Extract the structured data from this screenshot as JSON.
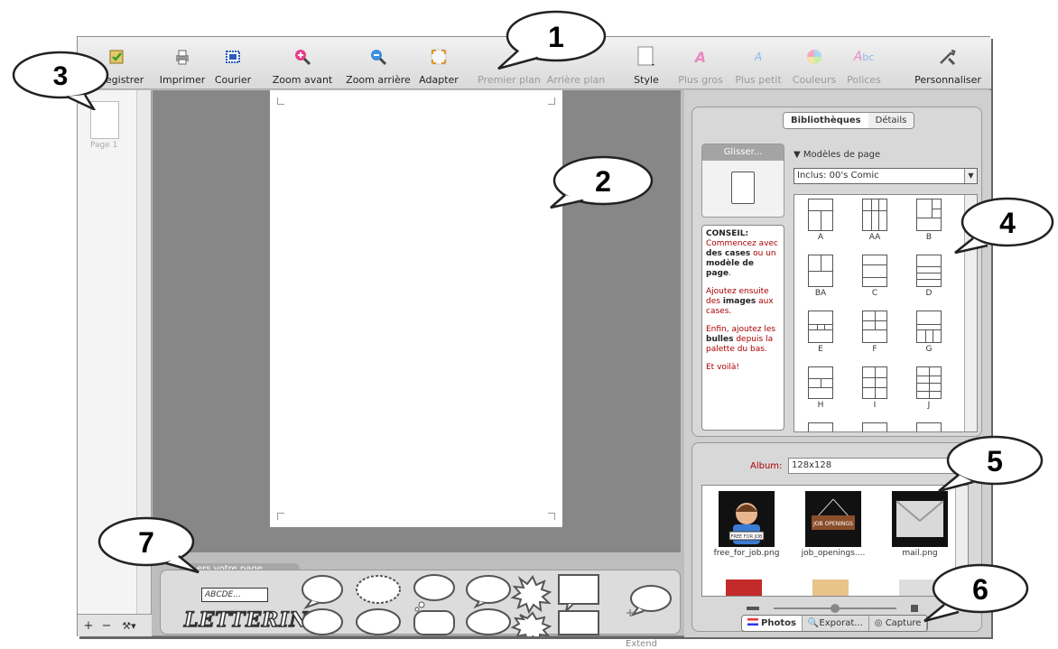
{
  "toolbar": {
    "items": [
      {
        "label": "Enregistrer",
        "icon": "save-icon",
        "enabled": true
      },
      {
        "label": "Imprimer",
        "icon": "print-icon",
        "enabled": true
      },
      {
        "label": "Courier",
        "icon": "mail-icon",
        "enabled": true
      },
      {
        "label": "Zoom avant",
        "icon": "zoom-in-icon",
        "enabled": true
      },
      {
        "label": "Zoom arrière",
        "icon": "zoom-out-icon",
        "enabled": true
      },
      {
        "label": "Adapter",
        "icon": "fit-icon",
        "enabled": true
      },
      {
        "label": "Premier plan",
        "icon": "bring-front-icon",
        "enabled": false
      },
      {
        "label": "Arrière plan",
        "icon": "send-back-icon",
        "enabled": false
      },
      {
        "label": "Style",
        "icon": "style-icon",
        "enabled": true
      },
      {
        "label": "Plus gros",
        "icon": "font-bigger-icon",
        "enabled": false
      },
      {
        "label": "Plus petit",
        "icon": "font-smaller-icon",
        "enabled": false
      },
      {
        "label": "Couleurs",
        "icon": "colors-icon",
        "enabled": false
      },
      {
        "label": "Polices",
        "icon": "fonts-icon",
        "enabled": false
      },
      {
        "label": "Personnaliser",
        "icon": "customize-icon",
        "enabled": true
      }
    ]
  },
  "pagestrip": {
    "thumb_label": "Page 1",
    "buttons": [
      "+",
      "−",
      "⚒▾"
    ]
  },
  "palette": {
    "tab_label": "…ers votre page",
    "text_sample": "ABCDE...",
    "lettering": "LETTERING",
    "extend_label": "Extend"
  },
  "library": {
    "tabs": [
      "Bibliothèques",
      "Détails"
    ],
    "drag_label": "Glisser...",
    "section": "Modèles de page",
    "select_value": "Inclus: 00's Comic",
    "tip": {
      "title": "CONSEIL:",
      "p1a": "Commencez avec ",
      "p1b": "des cases",
      "p1c": " ou un ",
      "p1d": "modèle de page",
      "p1e": ".",
      "p2a": "Ajoutez ensuite des ",
      "p2b": "images",
      "p2c": " aux cases.",
      "p3a": "Enfin, ajoutez les ",
      "p3b": "bulles",
      "p3c": " depuis la palette du bas.",
      "p4": "Et voilà!"
    },
    "templates": [
      "A",
      "AA",
      "B",
      "BA",
      "C",
      "D",
      "E",
      "F",
      "G",
      "H",
      "I",
      "J"
    ]
  },
  "album": {
    "label": "Album:",
    "value": "128x128",
    "photos": [
      {
        "name": "free_for_job.png",
        "badge": "FREE FOR JOB"
      },
      {
        "name": "job_openings....",
        "badge": "JOB OPENINGS"
      },
      {
        "name": "mail.png",
        "badge": ""
      }
    ],
    "tabs": [
      "Photos",
      "Exporat...",
      "Capture"
    ]
  },
  "callouts": [
    "1",
    "2",
    "3",
    "4",
    "5",
    "6",
    "7"
  ]
}
